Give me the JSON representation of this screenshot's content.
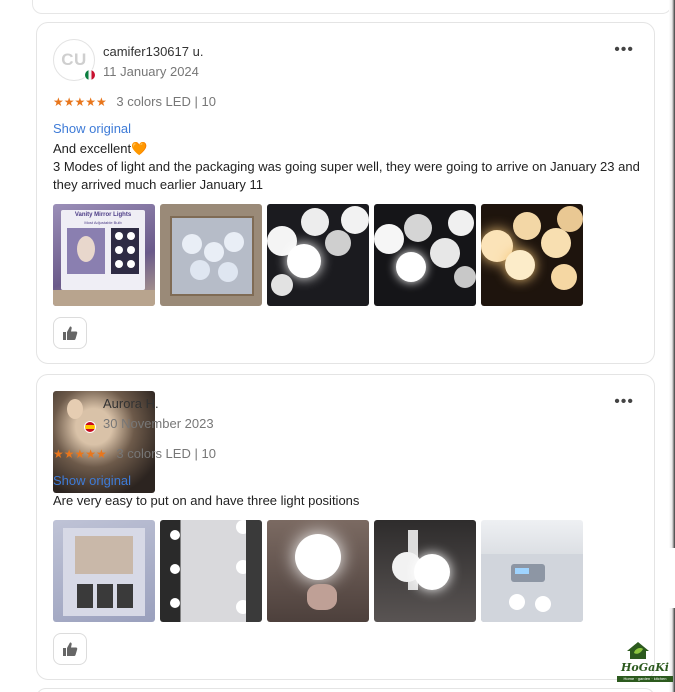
{
  "reviews": [
    {
      "author": "camifer130617 u.",
      "avatar_initials": "CU",
      "date": "11 January 2024",
      "rating": "★★★★★",
      "variant": "3 colors LED",
      "separator": "|",
      "variant_size": "10",
      "show_original": "Show original",
      "text_line1": "And excellent",
      "text_emoji": "🧡",
      "text_line2": "3 Modes of light and the packaging was going super well, they were going to arrive on January 23 and they arrived much earlier January 11",
      "photo_count": 5
    },
    {
      "author": "Aurora H.",
      "date": "30 November 2023",
      "rating": "★★★★★",
      "variant": "3 colors LED",
      "separator": "|",
      "variant_size": "10",
      "show_original": "Show original",
      "text_line1": "Are very easy to put on and have three light positions",
      "photo_count": 5
    }
  ],
  "more_icon": "more-horizontal-icon",
  "like_icon": "thumbs-up-icon",
  "product_box_text": {
    "title": "Vanity Mirror Lights",
    "subtitle": "Most Adjustable Bulb"
  },
  "watermark": {
    "brand": "HoGaKi",
    "tagline": "Home · garden · kitchen"
  },
  "colors": {
    "star": "#e8761c",
    "link": "#3e7bd7",
    "brand_green": "#2c5a1e"
  }
}
